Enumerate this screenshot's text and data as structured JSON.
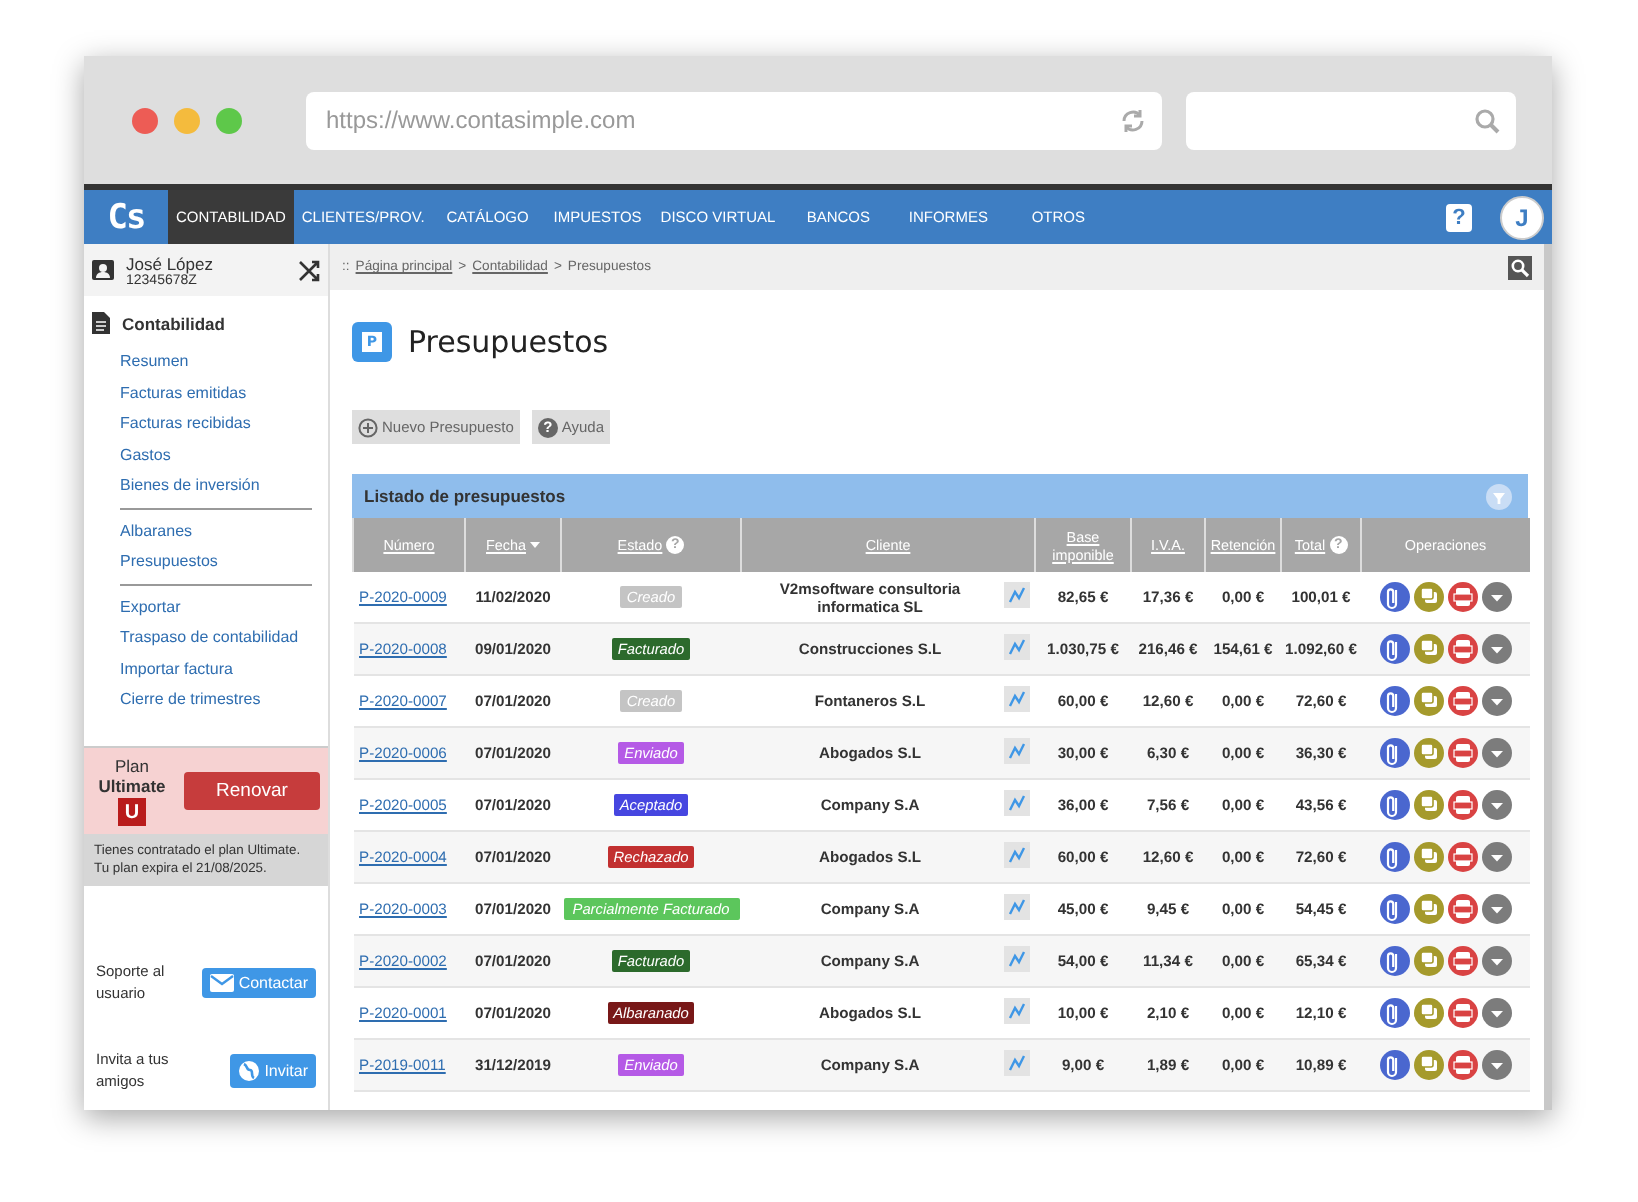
{
  "browser": {
    "url": "https://www.contasimple.com"
  },
  "nav": {
    "logo": "Cs",
    "items": [
      {
        "label": "CONTABILIDAD",
        "selected": true
      },
      {
        "label": "CLIENTES/PROV.",
        "selected": false
      },
      {
        "label": "CATÁLOGO",
        "selected": false
      },
      {
        "label": "IMPUESTOS",
        "selected": false
      },
      {
        "label": "DISCO VIRTUAL",
        "selected": false
      },
      {
        "label": "BANCOS",
        "selected": false
      },
      {
        "label": "INFORMES",
        "selected": false
      },
      {
        "label": "OTROS",
        "selected": false
      }
    ],
    "help": "?",
    "avatar": "J"
  },
  "sidebar": {
    "user": {
      "name": "José López",
      "id": "12345678Z"
    },
    "section": "Contabilidad",
    "groups": [
      [
        "Resumen",
        "Facturas emitidas",
        "Facturas recibidas",
        "Gastos",
        "Bienes de inversión"
      ],
      [
        "Albaranes",
        "Presupuestos"
      ],
      [
        "Exportar",
        "Traspaso de contabilidad",
        "Importar factura",
        "Cierre de trimestres"
      ]
    ],
    "plan": {
      "label": "Plan",
      "name": "Ultimate",
      "badge": "U",
      "button": "Renovar",
      "note": [
        "Tienes contratado el plan Ultimate.",
        "Tu plan expira el 21/08/2025."
      ]
    },
    "support": {
      "label": "Soporte al usuario",
      "button": "Contactar"
    },
    "invite": {
      "label": "Invita a tus amigos",
      "button": "Invitar"
    }
  },
  "breadcrumb": [
    {
      "label": "::",
      "kind": "text"
    },
    {
      "label": "Página principal",
      "kind": "link"
    },
    {
      "label": ">",
      "kind": "text"
    },
    {
      "label": "Contabilidad",
      "kind": "link"
    },
    {
      "label": ">",
      "kind": "text"
    },
    {
      "label": "Presupuestos",
      "kind": "text"
    }
  ],
  "title_icon": "P",
  "title": "Presupuestos",
  "toolbar": [
    {
      "label": "Nuevo Presupuesto",
      "kind": "add"
    },
    {
      "label": "Ayuda",
      "kind": "help",
      "icon": "?"
    }
  ],
  "listing": {
    "title": "Listado de presupuestos",
    "columns": [
      {
        "label": "Número",
        "link": true,
        "sorted": false
      },
      {
        "label": "Fecha",
        "link": true,
        "sorted": true
      },
      {
        "label": "Estado",
        "link": true,
        "help": "?",
        "sorted": false
      },
      {
        "label": "Cliente",
        "link": true,
        "sorted": false
      },
      {
        "label": "Base imponible",
        "link": true,
        "sorted": false
      },
      {
        "label": "I.V.A.",
        "link": true,
        "sorted": false
      },
      {
        "label": "Retención",
        "link": true,
        "sorted": false
      },
      {
        "label": "Total",
        "link": true,
        "help": "?",
        "sorted": false
      },
      {
        "label": "Operaciones",
        "link": false,
        "sorted": false
      }
    ],
    "rows": [
      {
        "number": "P-2020-0009",
        "date": "11/02/2020",
        "status": {
          "label": "Creado",
          "color": "#c4c4c4"
        },
        "client": "V2msoftware consultoria informatica SL",
        "base": "82,65 €",
        "iva": "17,36 €",
        "retention": "0,00 €",
        "total": "100,01 €"
      },
      {
        "number": "P-2020-0008",
        "date": "09/01/2020",
        "status": {
          "label": "Facturado",
          "color": "#2c6a2c"
        },
        "client": "Construcciones S.L",
        "base": "1.030,75 €",
        "iva": "216,46 €",
        "retention": "154,61 €",
        "total": "1.092,60 €"
      },
      {
        "number": "P-2020-0007",
        "date": "07/01/2020",
        "status": {
          "label": "Creado",
          "color": "#c4c4c4"
        },
        "client": "Fontaneros S.L",
        "base": "60,00 €",
        "iva": "12,60 €",
        "retention": "0,00 €",
        "total": "72,60 €"
      },
      {
        "number": "P-2020-0006",
        "date": "07/01/2020",
        "status": {
          "label": "Enviado",
          "color": "#b55ae6"
        },
        "client": "Abogados S.L",
        "base": "30,00 €",
        "iva": "6,30 €",
        "retention": "0,00 €",
        "total": "36,30 €"
      },
      {
        "number": "P-2020-0005",
        "date": "07/01/2020",
        "status": {
          "label": "Aceptado",
          "color": "#4646e0"
        },
        "client": "Company S.A",
        "base": "36,00 €",
        "iva": "7,56 €",
        "retention": "0,00 €",
        "total": "43,56 €"
      },
      {
        "number": "P-2020-0004",
        "date": "07/01/2020",
        "status": {
          "label": "Rechazado",
          "color": "#c23030"
        },
        "client": "Abogados S.L",
        "base": "60,00 €",
        "iva": "12,60 €",
        "retention": "0,00 €",
        "total": "72,60 €"
      },
      {
        "number": "P-2020-0003",
        "date": "07/01/2020",
        "status": {
          "label": "Parcialmente Facturado",
          "color": "#5cc65c"
        },
        "client": "Company S.A",
        "base": "45,00 €",
        "iva": "9,45 €",
        "retention": "0,00 €",
        "total": "54,45 €"
      },
      {
        "number": "P-2020-0002",
        "date": "07/01/2020",
        "status": {
          "label": "Facturado",
          "color": "#2c6a2c"
        },
        "client": "Company S.A",
        "base": "54,00 €",
        "iva": "11,34 €",
        "retention": "0,00 €",
        "total": "65,34 €"
      },
      {
        "number": "P-2020-0001",
        "date": "07/01/2020",
        "status": {
          "label": "Albaranado",
          "color": "#781818"
        },
        "client": "Abogados S.L",
        "base": "10,00 €",
        "iva": "2,10 €",
        "retention": "0,00 €",
        "total": "12,10 €"
      },
      {
        "number": "P-2019-0011",
        "date": "31/12/2019",
        "status": {
          "label": "Enviado",
          "color": "#b55ae6"
        },
        "client": "Company S.A",
        "base": "9,00 €",
        "iva": "1,89 €",
        "retention": "0,00 €",
        "total": "10,89 €"
      }
    ]
  }
}
